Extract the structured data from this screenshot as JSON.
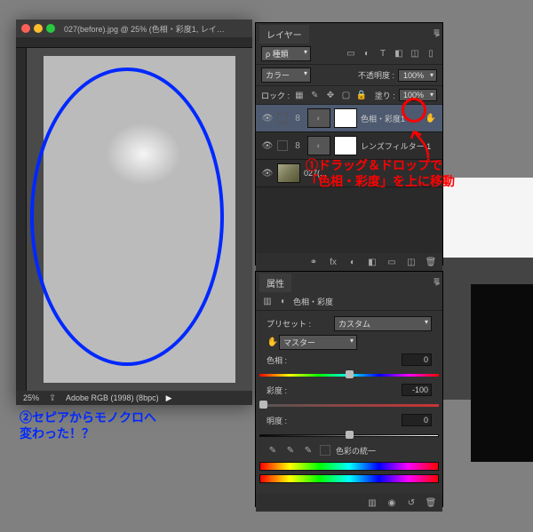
{
  "doc": {
    "title": "027(before).jpg @ 25% (色相・彩度1, レイ…",
    "zoom": "25%",
    "color_profile": "Adobe RGB (1998) (8bpc)"
  },
  "layers_panel": {
    "tab": "レイヤー",
    "kind_label": "ρ 種類",
    "color_label": "カラー",
    "opacity_label": "不透明度 :",
    "opacity_value": "100%",
    "lock_label": "ロック :",
    "fill_label": "塗り :",
    "fill_value": "100%",
    "layers": [
      {
        "name": "色相・彩度1",
        "type": "adjustment"
      },
      {
        "name": "レンズフィルター 1",
        "type": "adjustment"
      },
      {
        "name": "027(...",
        "type": "image"
      }
    ],
    "footer_icons": [
      "⚭",
      "fx",
      "◐",
      "◧",
      "▭",
      "◫",
      "🗑"
    ]
  },
  "attributes_panel": {
    "tab": "属性",
    "adj_title": "色相・彩度",
    "preset_label": "プリセット :",
    "preset_value": "カスタム",
    "channel_value": "マスター",
    "hue_label": "色相 :",
    "hue_value": "0",
    "sat_label": "彩度 :",
    "sat_value": "-100",
    "light_label": "明度 :",
    "light_value": "0",
    "colorize_label": "色彩の統一"
  },
  "annotations": {
    "red": "①ドラッグ＆ドロップで\n「色相・彩度」を上に移動",
    "blue": "②セピアからモノクロへ\n変わった！？"
  }
}
